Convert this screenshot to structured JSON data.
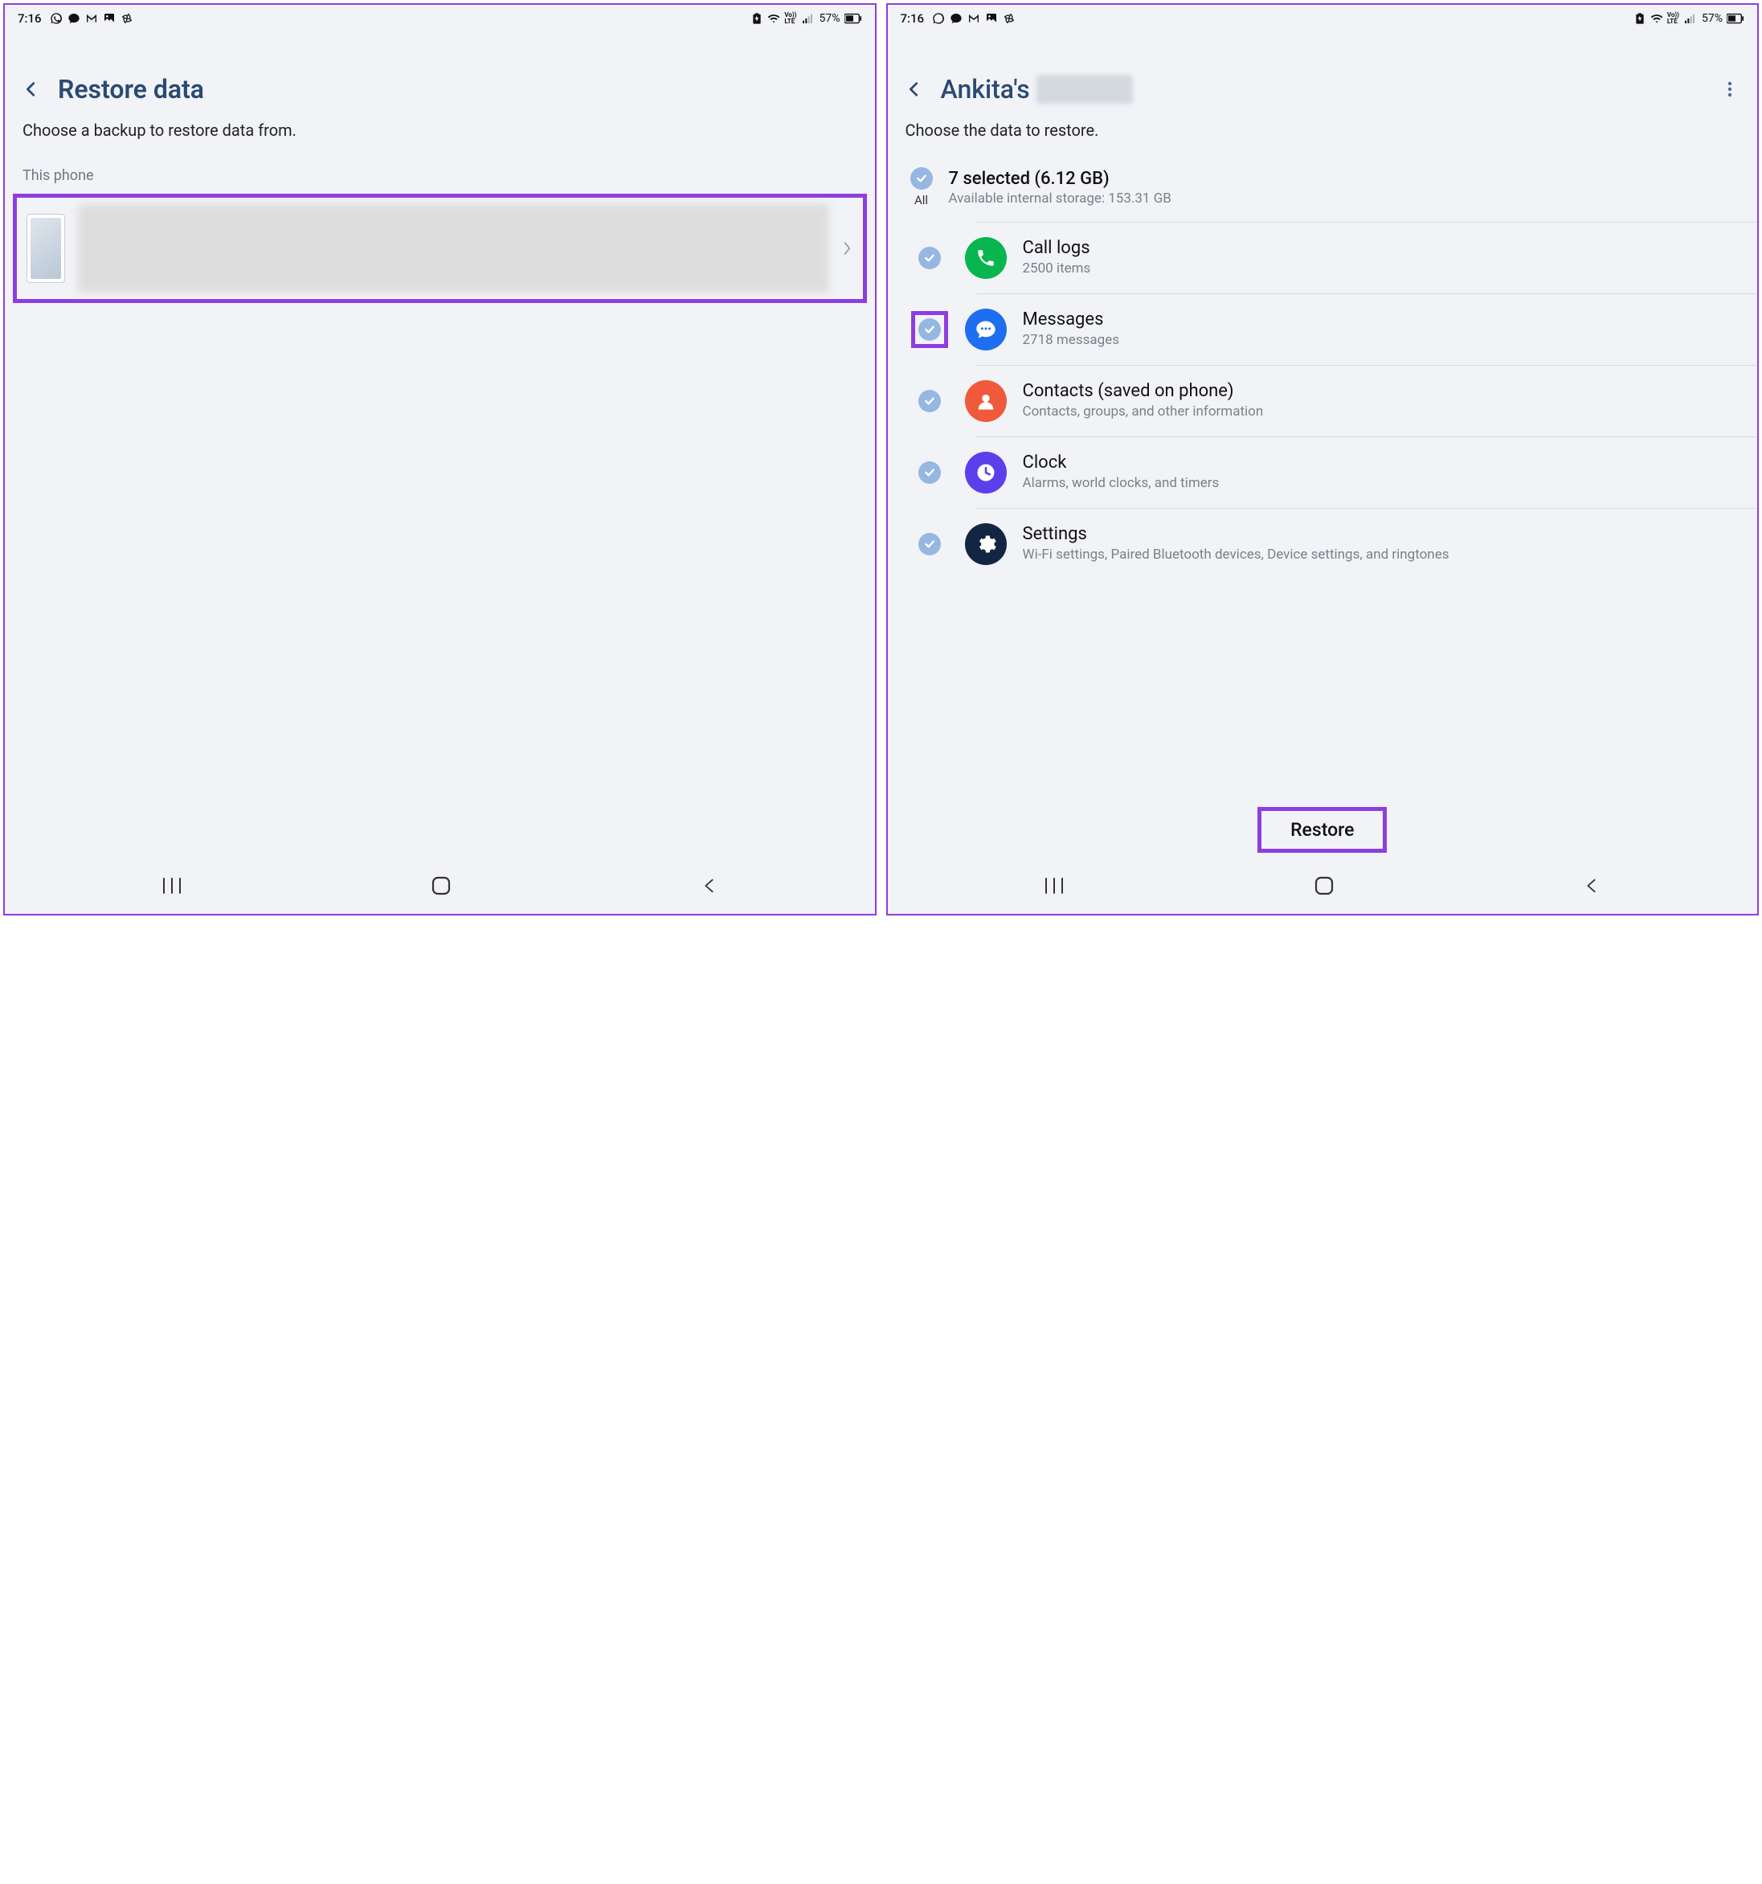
{
  "status": {
    "time": "7:16",
    "battery_pct": "57%"
  },
  "left": {
    "title": "Restore data",
    "desc": "Choose a backup to restore data from.",
    "section": "This phone"
  },
  "right": {
    "title_prefix": "Ankita's",
    "desc": "Choose the data to restore.",
    "all_label": "All",
    "summary_title": "7 selected (6.12 GB)",
    "summary_sub": "Available internal storage: 153.31 GB",
    "items": [
      {
        "title": "Call logs",
        "sub": "2500 items"
      },
      {
        "title": "Messages",
        "sub": "2718 messages"
      },
      {
        "title": "Contacts (saved on phone)",
        "sub": "Contacts, groups, and other information"
      },
      {
        "title": "Clock",
        "sub": "Alarms, world clocks, and timers"
      },
      {
        "title": "Settings",
        "sub": "Wi-Fi settings, Paired Bluetooth devices, Device settings, and ringtones"
      }
    ],
    "restore_label": "Restore"
  }
}
